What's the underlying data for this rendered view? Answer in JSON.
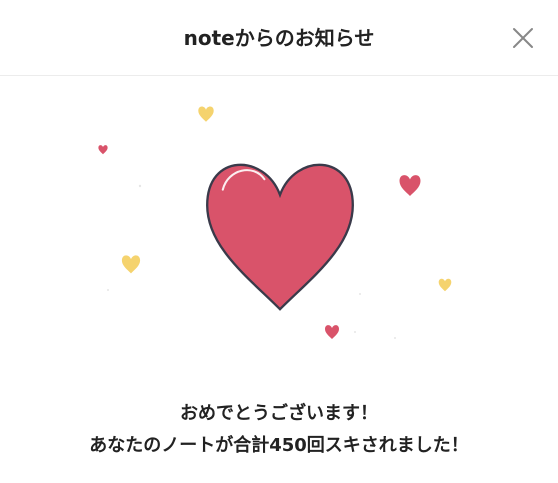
{
  "dialog": {
    "title": "noteからのお知らせ",
    "close_icon": "close-icon",
    "message_line1": "おめでとうございます！",
    "message_line2": "あなたのノートが合計450回スキされました！"
  },
  "illustration": {
    "main_icon": "heart-icon",
    "main_heart_color": "#d9536a",
    "outline_color": "#3a3a4a",
    "accent_red": "#d9536a",
    "accent_yellow": "#f5d36e"
  }
}
